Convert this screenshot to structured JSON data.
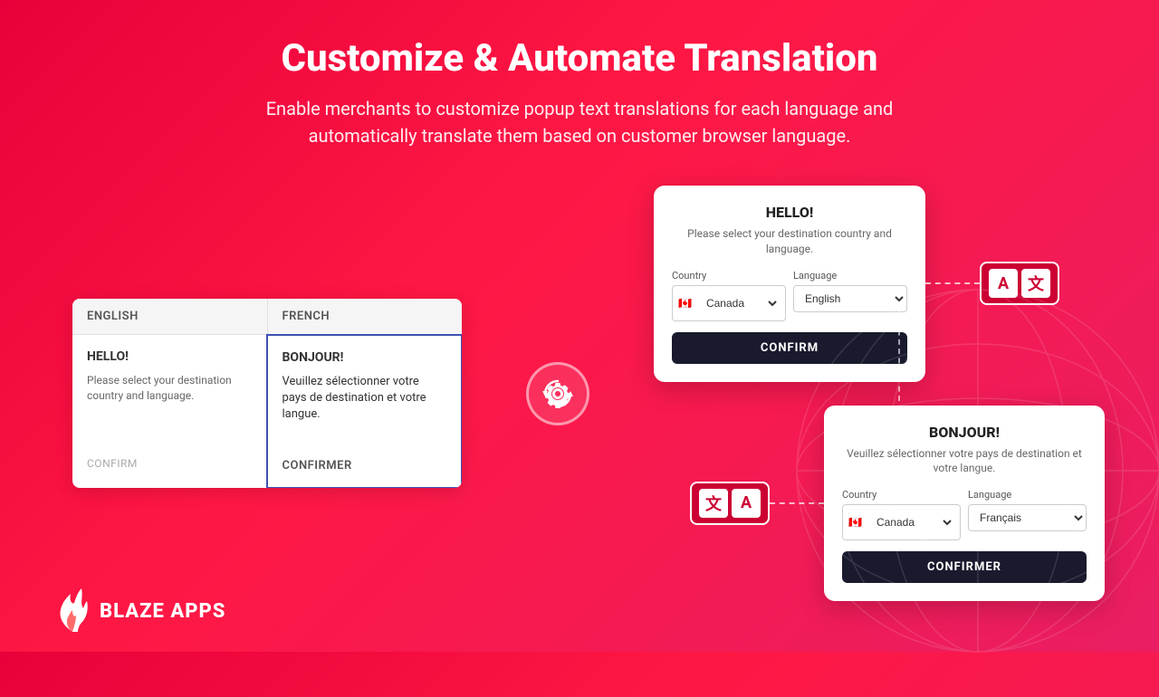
{
  "header": {
    "title": "Customize & Automate Translation",
    "subtitle": "Enable merchants to customize popup text translations for each language and automatically translate them based on customer browser language."
  },
  "table": {
    "col1_header": "ENGLISH",
    "col2_header": "FRENCH",
    "english": {
      "hello": "HELLO!",
      "body": "Please select your destination country and language.",
      "confirm": "CONFIRM"
    },
    "french": {
      "hello": "BONJOUR!",
      "body": "Veuillez sélectionner votre pays de destination et votre langue.",
      "confirm": "CONFIRMER"
    }
  },
  "popup_english": {
    "title": "HELLO!",
    "subtitle": "Please select your destination country and language.",
    "country_label": "Country",
    "language_label": "Language",
    "country_value": "Canada",
    "language_value": "English",
    "confirm_btn": "CONFIRM"
  },
  "popup_french": {
    "title": "BONJOUR!",
    "subtitle": "Veuillez sélectionner votre pays de destination et votre langue.",
    "country_label": "Country",
    "language_label": "Language",
    "country_value": "Canada",
    "language_value": "Français",
    "confirm_btn": "CONFIRMER"
  },
  "logo": {
    "brand": "BLAZE APPS"
  },
  "translation_icons": {
    "letter_a_latin": "A",
    "letter_a_cjk": "文"
  }
}
